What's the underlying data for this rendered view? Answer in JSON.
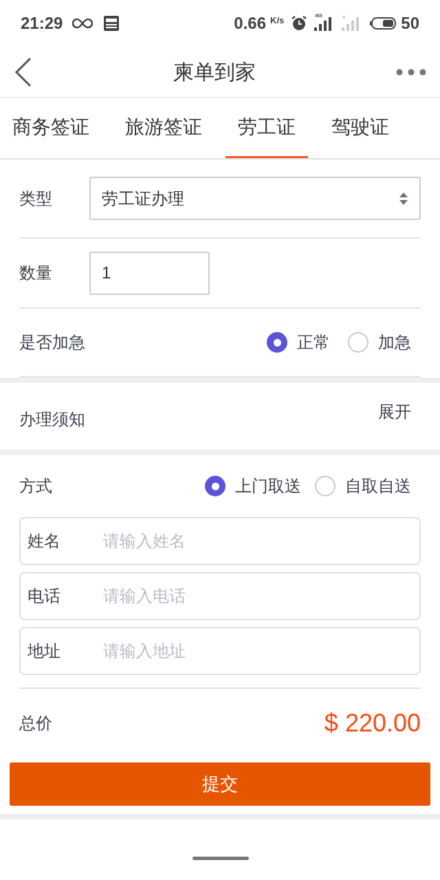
{
  "status_bar": {
    "time": "21:29",
    "speed": "0.66",
    "speed_unit": "K/s",
    "network": "4G",
    "battery": "50"
  },
  "header": {
    "title": "柬单到家"
  },
  "tabs": [
    {
      "label": "商务签证",
      "selected": false
    },
    {
      "label": "旅游签证",
      "selected": false
    },
    {
      "label": "劳工证",
      "selected": true
    },
    {
      "label": "驾驶证",
      "selected": false
    }
  ],
  "form": {
    "type": {
      "label": "类型",
      "value": "劳工证办理"
    },
    "quantity": {
      "label": "数量",
      "value": "1"
    },
    "urgent": {
      "label": "是否加急",
      "options": [
        {
          "label": "正常",
          "selected": true
        },
        {
          "label": "加急",
          "selected": false
        }
      ]
    }
  },
  "notice": {
    "label": "办理须知",
    "toggle": "展开"
  },
  "delivery": {
    "label": "方式",
    "options": [
      {
        "label": "上门取送",
        "selected": true
      },
      {
        "label": "自取自送",
        "selected": false
      }
    ],
    "fields": [
      {
        "label": "姓名",
        "placeholder": "请输入姓名"
      },
      {
        "label": "电话",
        "placeholder": "请输入电话"
      },
      {
        "label": "地址",
        "placeholder": "请输入地址"
      }
    ]
  },
  "total": {
    "label": "总价",
    "value": "$ 220.00"
  },
  "submit": "提交"
}
